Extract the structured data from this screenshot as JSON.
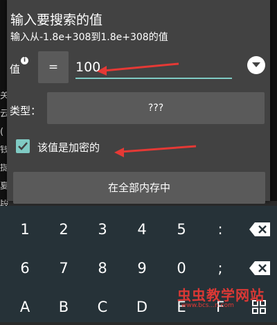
{
  "dialog": {
    "title": "输入要搜索的值",
    "subtitle": "输入从-1.8e+308到1.8e+308的值",
    "value_label": "值",
    "info_icon": "i",
    "operator": "=",
    "value": "100",
    "type_label": "类型：",
    "type_value": "???",
    "encrypted_label": "该值是加密的",
    "encrypted_checked": true,
    "search_button": "在全部内存中"
  },
  "keyboard": {
    "row1": [
      "1",
      "2",
      "3",
      "4",
      "5",
      ":"
    ],
    "row2": [
      "6",
      "7",
      "8",
      "9",
      "0",
      ";"
    ],
    "row3": [
      "A",
      "B",
      "C",
      "D",
      "E",
      "F"
    ]
  },
  "watermark": "虫虫教学网站",
  "watermark_url": "www.bcs...n.com",
  "colors": {
    "dialog_bg": "#424242",
    "button_bg": "#5a5a5a",
    "accent": "#80cbc4",
    "keyboard_bg": "#263238",
    "annotation_arrow": "#e53935"
  }
}
